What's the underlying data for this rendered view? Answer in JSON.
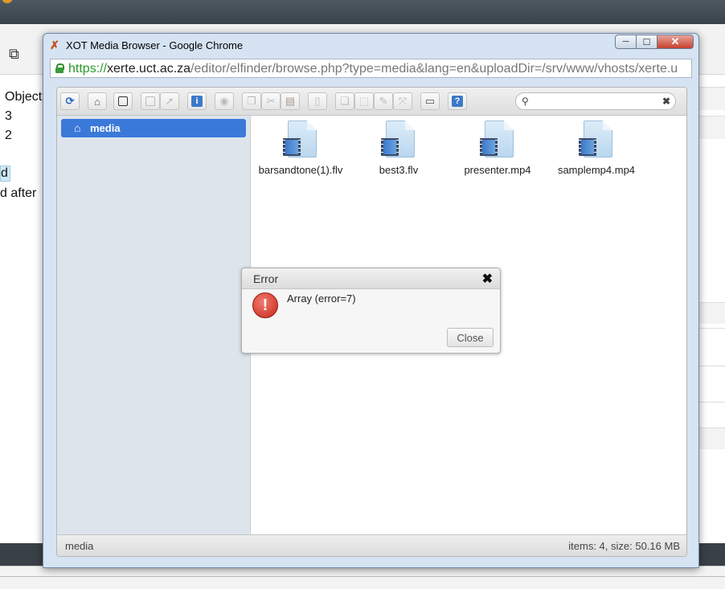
{
  "background": {
    "side_texts": [
      "Object",
      "3",
      "2",
      "d",
      "d after"
    ]
  },
  "window": {
    "title": "XOT Media Browser - Google Chrome",
    "buttons": {
      "minimize": "─",
      "maximize": "☐",
      "close": "✕"
    }
  },
  "address_bar": {
    "scheme": "https://",
    "host": "xerte.uct.ac.za",
    "path": "/editor/elfinder/browse.php?type=media&lang=en&uploadDir=/srv/www/vhosts/xerte.u"
  },
  "toolbar": {
    "search_placeholder": "",
    "search_clear": "✖"
  },
  "navbar": {
    "items": [
      {
        "label": "media"
      }
    ]
  },
  "files": [
    {
      "name": "barsandtone(1).flv"
    },
    {
      "name": "best3.flv"
    },
    {
      "name": "presenter.mp4"
    },
    {
      "name": "samplemp4.mp4"
    }
  ],
  "statusbar": {
    "path": "media",
    "stat": "items: 4, size: 50.16 MB"
  },
  "dialog": {
    "title": "Error",
    "close_glyph": "✖",
    "message": "Array (error=7)",
    "button": "Close"
  },
  "colors": {
    "nav_selected": "#3b79d9",
    "error_icon": "#c6281c",
    "url_scheme": "#2a9a2a"
  }
}
